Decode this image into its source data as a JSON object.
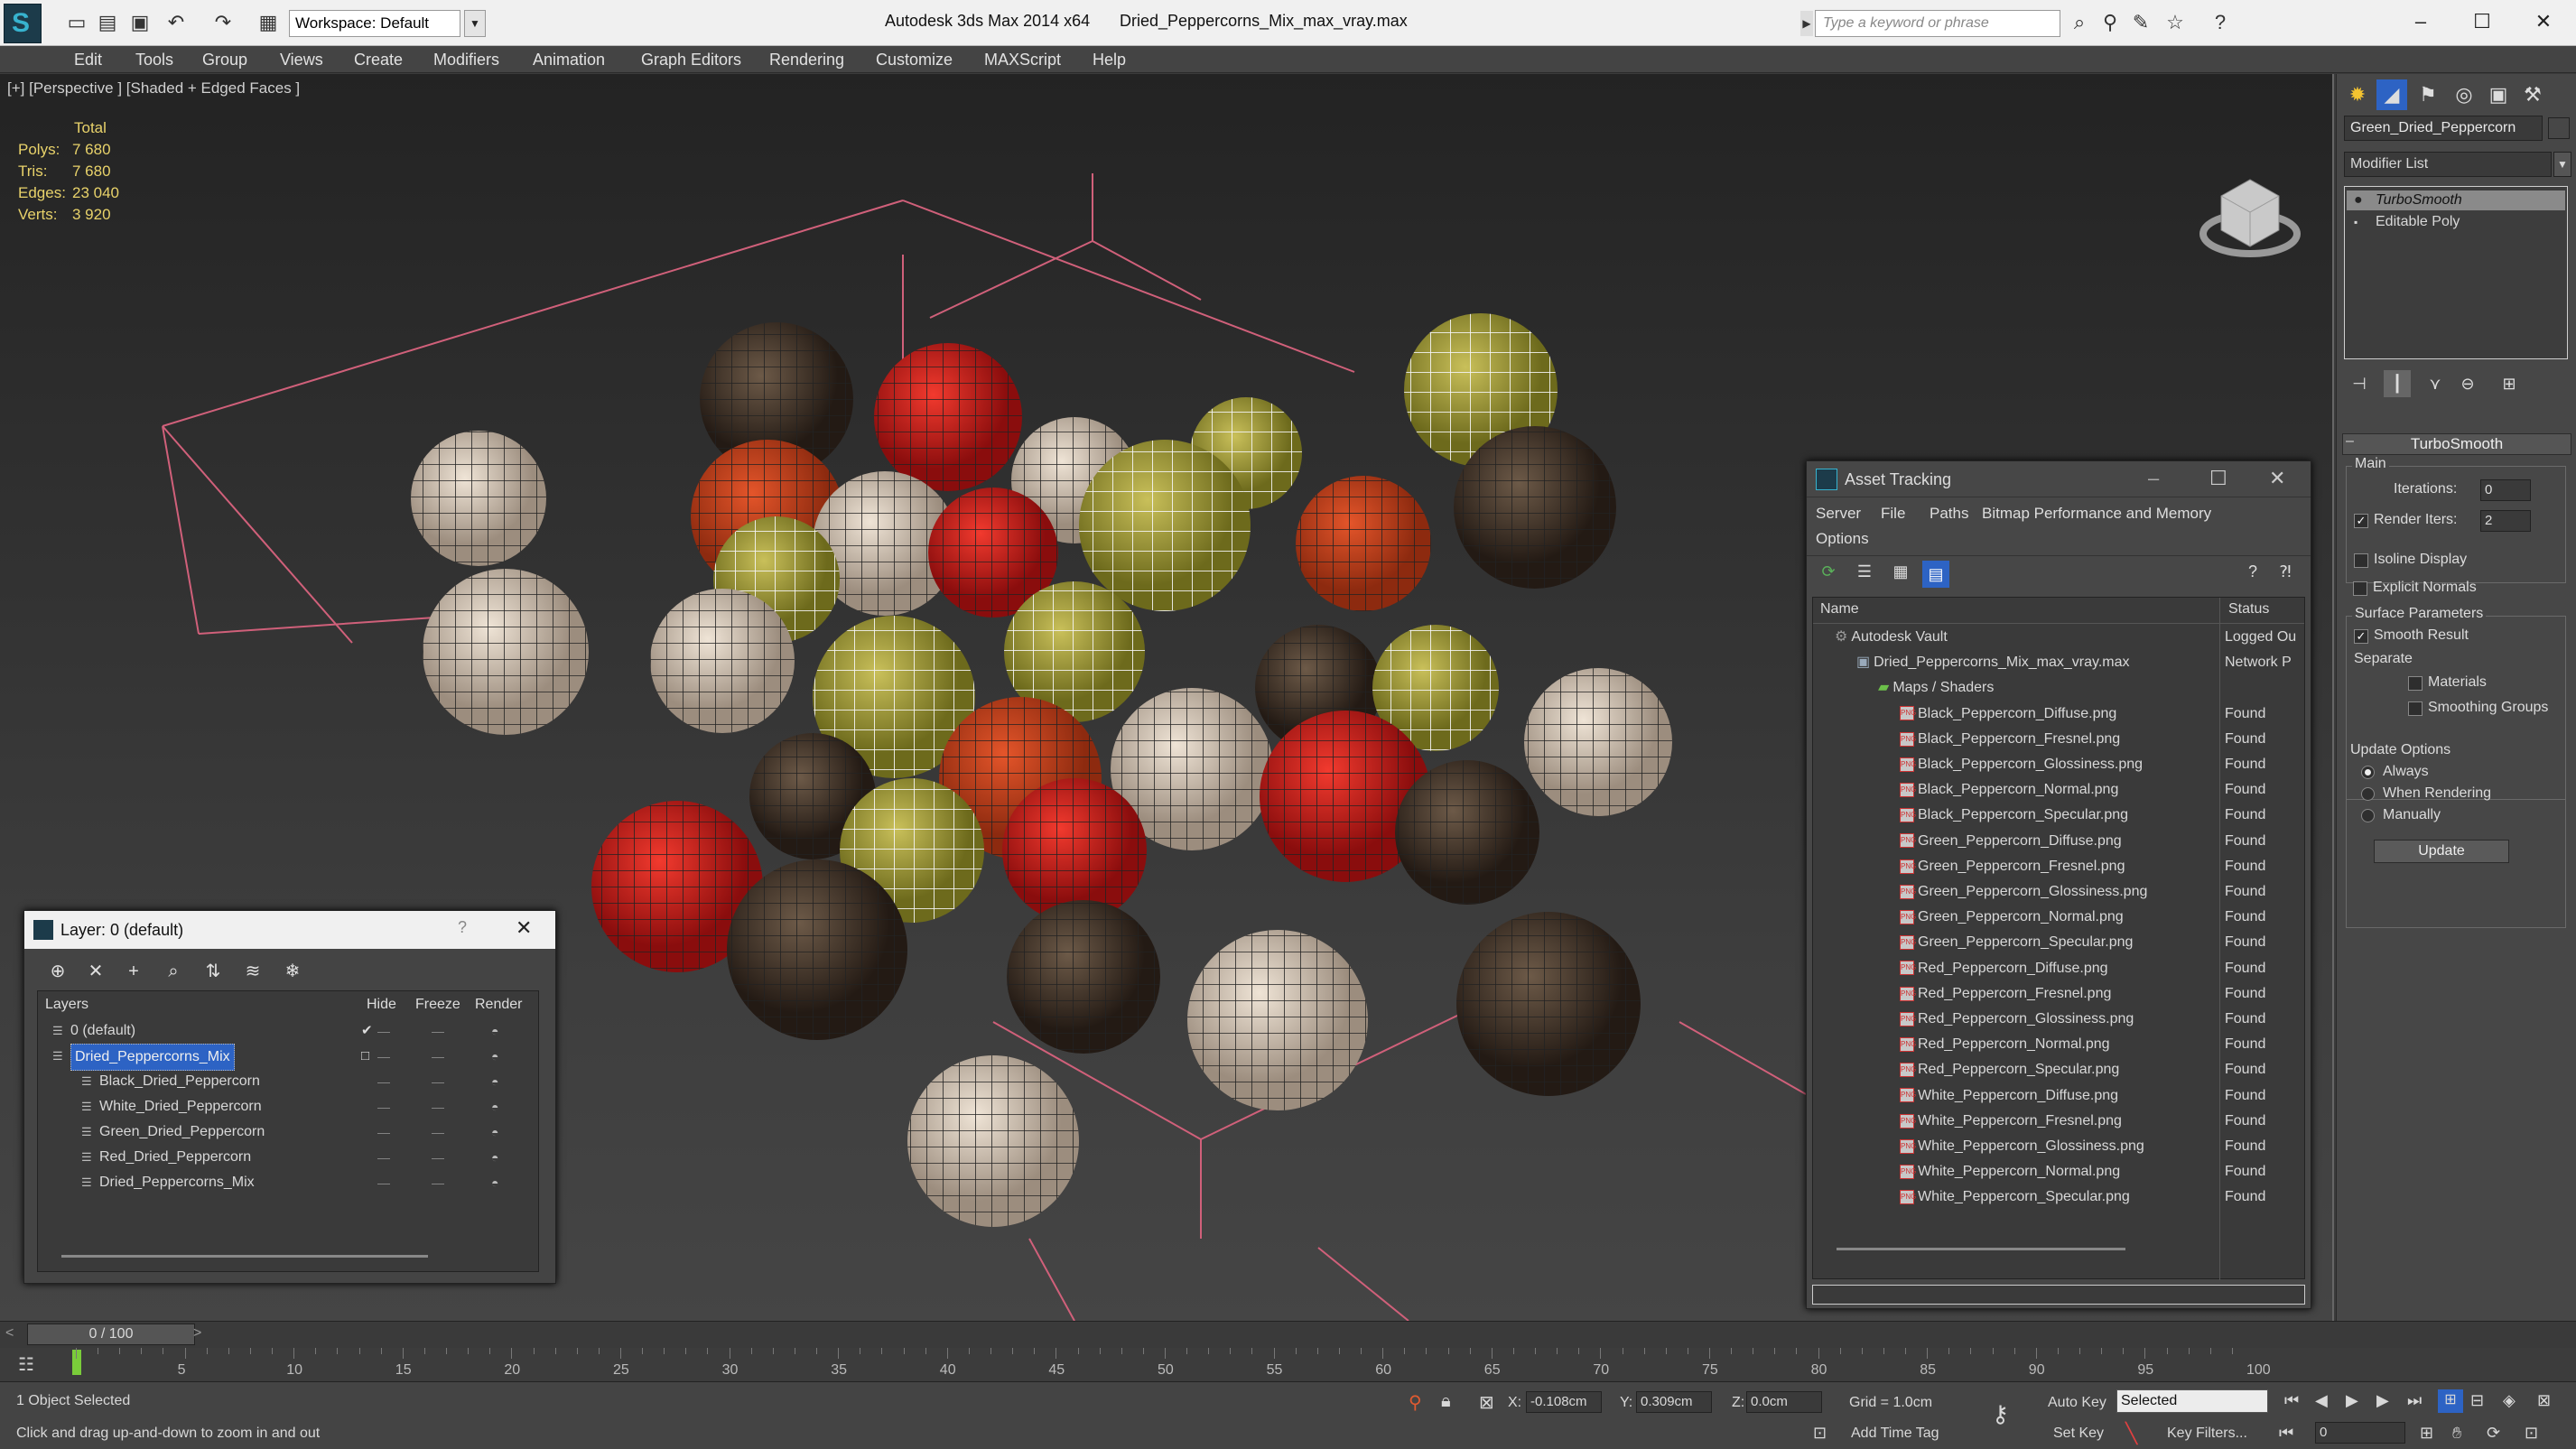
{
  "titlebar": {
    "workspace": "Workspace: Default",
    "app_title": "Autodesk 3ds Max  2014 x64",
    "file_name": "Dried_Peppercorns_Mix_max_vray.max",
    "search_placeholder": "Type a keyword or phrase"
  },
  "menu": [
    "Edit",
    "Tools",
    "Group",
    "Views",
    "Create",
    "Modifiers",
    "Animation",
    "Graph Editors",
    "Rendering",
    "Customize",
    "MAXScript",
    "Help"
  ],
  "viewport": {
    "label": "[+] [Perspective ] [Shaded + Edged Faces ]",
    "stats_header": "Total",
    "stats": [
      {
        "k": "Polys:",
        "v": "7 680"
      },
      {
        "k": "Tris:",
        "v": "7 680"
      },
      {
        "k": "Edges:",
        "v": "23 040"
      },
      {
        "k": "Verts:",
        "v": "3 920"
      }
    ]
  },
  "command_panel": {
    "object_name": "Green_Dried_Peppercorn",
    "modifier_list": "Modifier List",
    "stack": [
      "TurboSmooth",
      "Editable Poly"
    ],
    "rollout": "TurboSmooth",
    "main_group": "Main",
    "iterations_label": "Iterations:",
    "iterations": "0",
    "render_iters_label": "Render Iters:",
    "render_iters": "2",
    "isoline": "Isoline Display",
    "explicit_normals": "Explicit Normals",
    "surface_params": "Surface Parameters",
    "smooth_result": "Smooth Result",
    "separate": "Separate",
    "materials": "Materials",
    "smoothing_groups": "Smoothing Groups",
    "update_options": "Update Options",
    "always": "Always",
    "when_rendering": "When Rendering",
    "manually": "Manually",
    "update_btn": "Update"
  },
  "layer_dialog": {
    "title": "Layer: 0 (default)",
    "help": "?",
    "cols": [
      "Layers",
      "Hide",
      "Freeze",
      "Render"
    ],
    "rows": [
      {
        "name": "0 (default)",
        "indent": 0,
        "check": "✔"
      },
      {
        "name": "Dried_Peppercorns_Mix",
        "indent": 0,
        "check": "□",
        "selected": true
      },
      {
        "name": "Black_Dried_Peppercorn",
        "indent": 1
      },
      {
        "name": "White_Dried_Peppercorn",
        "indent": 1
      },
      {
        "name": "Green_Dried_Peppercorn",
        "indent": 1
      },
      {
        "name": "Red_Dried_Peppercorn",
        "indent": 1
      },
      {
        "name": "Dried_Peppercorns_Mix",
        "indent": 1
      }
    ]
  },
  "asset_dialog": {
    "title": "Asset Tracking",
    "menu": [
      "Server",
      "File",
      "Paths",
      "Bitmap Performance and Memory"
    ],
    "menu2": "Options",
    "cols": [
      "Name",
      "Status"
    ],
    "rows": [
      {
        "name": "Autodesk Vault",
        "status": "Logged Ou",
        "indent": 0
      },
      {
        "name": "Dried_Peppercorns_Mix_max_vray.max",
        "status": "Network P",
        "indent": 1
      },
      {
        "name": "Maps / Shaders",
        "status": "",
        "indent": 2
      },
      {
        "name": "Black_Peppercorn_Diffuse.png",
        "status": "Found",
        "indent": 3
      },
      {
        "name": "Black_Peppercorn_Fresnel.png",
        "status": "Found",
        "indent": 3
      },
      {
        "name": "Black_Peppercorn_Glossiness.png",
        "status": "Found",
        "indent": 3
      },
      {
        "name": "Black_Peppercorn_Normal.png",
        "status": "Found",
        "indent": 3
      },
      {
        "name": "Black_Peppercorn_Specular.png",
        "status": "Found",
        "indent": 3
      },
      {
        "name": "Green_Peppercorn_Diffuse.png",
        "status": "Found",
        "indent": 3
      },
      {
        "name": "Green_Peppercorn_Fresnel.png",
        "status": "Found",
        "indent": 3
      },
      {
        "name": "Green_Peppercorn_Glossiness.png",
        "status": "Found",
        "indent": 3
      },
      {
        "name": "Green_Peppercorn_Normal.png",
        "status": "Found",
        "indent": 3
      },
      {
        "name": "Green_Peppercorn_Specular.png",
        "status": "Found",
        "indent": 3
      },
      {
        "name": "Red_Peppercorn_Diffuse.png",
        "status": "Found",
        "indent": 3
      },
      {
        "name": "Red_Peppercorn_Fresnel.png",
        "status": "Found",
        "indent": 3
      },
      {
        "name": "Red_Peppercorn_Glossiness.png",
        "status": "Found",
        "indent": 3
      },
      {
        "name": "Red_Peppercorn_Normal.png",
        "status": "Found",
        "indent": 3
      },
      {
        "name": "Red_Peppercorn_Specular.png",
        "status": "Found",
        "indent": 3
      },
      {
        "name": "White_Peppercorn_Diffuse.png",
        "status": "Found",
        "indent": 3
      },
      {
        "name": "White_Peppercorn_Fresnel.png",
        "status": "Found",
        "indent": 3
      },
      {
        "name": "White_Peppercorn_Glossiness.png",
        "status": "Found",
        "indent": 3
      },
      {
        "name": "White_Peppercorn_Normal.png",
        "status": "Found",
        "indent": 3
      },
      {
        "name": "White_Peppercorn_Specular.png",
        "status": "Found",
        "indent": 3
      }
    ]
  },
  "timeline": {
    "frame_display": "0 / 100",
    "ticks": [
      "5",
      "10",
      "15",
      "20",
      "25",
      "30",
      "35",
      "40",
      "45",
      "50",
      "55",
      "60",
      "65",
      "70",
      "75",
      "80",
      "85",
      "90",
      "95",
      "100"
    ]
  },
  "status": {
    "selection": "1 Object Selected",
    "prompt": "Click and drag up-and-down to zoom in and out",
    "x_label": "X:",
    "x": "-0.108cm",
    "y_label": "Y:",
    "y": "0.309cm",
    "z_label": "Z:",
    "z": "0.0cm",
    "grid": "Grid = 1.0cm",
    "add_time_tag": "Add Time Tag",
    "auto_key": "Auto Key",
    "selected": "Selected",
    "set_key": "Set Key",
    "key_filters": "Key Filters...",
    "frame": "0"
  },
  "colors": {
    "accent": "#2d63c4",
    "stats_text": "#e8d26a",
    "grid_line": "#d0607a"
  }
}
